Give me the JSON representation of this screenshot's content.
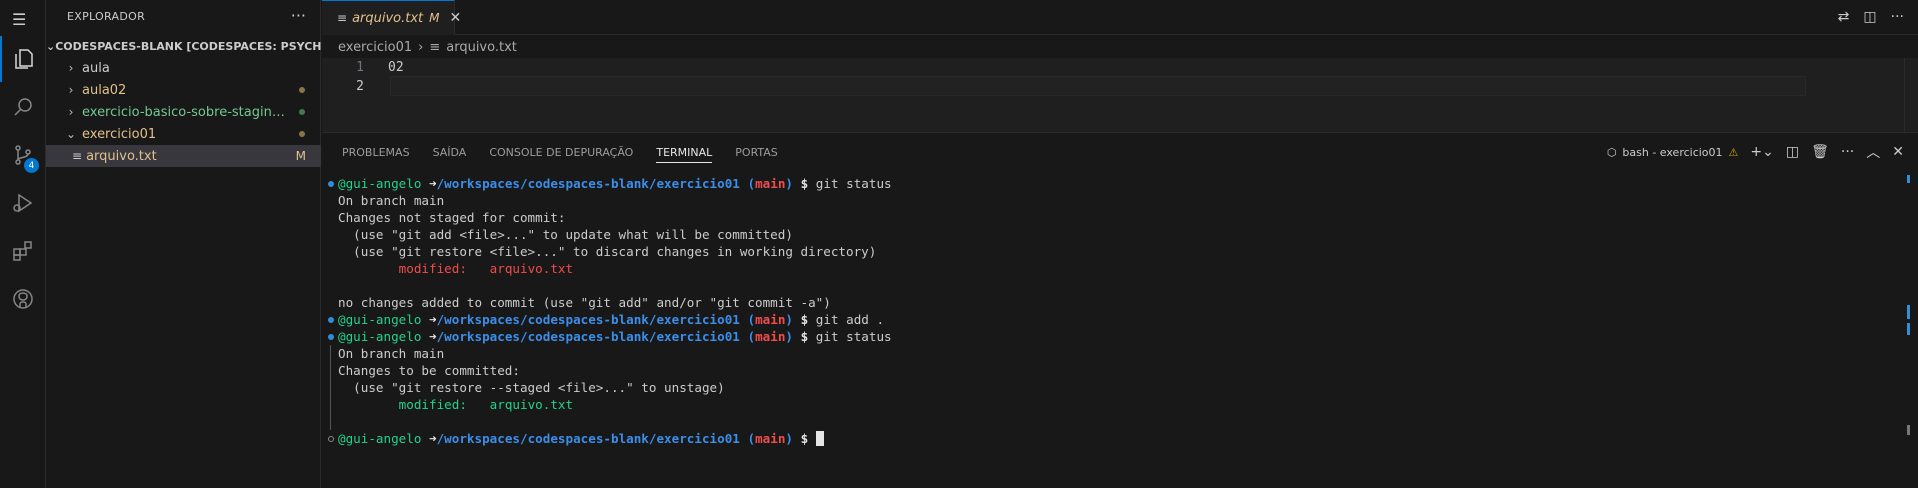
{
  "activity_bar": {
    "items": [
      "explorer",
      "search",
      "source-control",
      "run-debug",
      "extensions",
      "github"
    ],
    "source_control_badge": "4"
  },
  "sidebar": {
    "title": "EXPLORADOR",
    "more": "···",
    "workspace": "CODESPACES-BLANK [CODESPACES: PSYCHIC S...",
    "items": [
      {
        "label": "aula",
        "color": "#cccccc"
      },
      {
        "label": "aula02",
        "color": "#e2c08d"
      },
      {
        "label": "exercicio-basico-sobre-staging-e-...",
        "color": "#73c991"
      },
      {
        "label": "exercicio01",
        "color": "#e2c08d"
      },
      {
        "label": "arquivo.txt",
        "color": "#e2c08d",
        "status": "M"
      }
    ]
  },
  "editor": {
    "tab": {
      "label": "arquivo.txt",
      "status": "M",
      "close": "✕"
    },
    "breadcrumb": [
      "exercicio01",
      "arquivo.txt"
    ],
    "lines": [
      {
        "number": "1",
        "text": "02"
      },
      {
        "number": "2",
        "text": ""
      }
    ]
  },
  "panel": {
    "tabs": [
      "PROBLEMAS",
      "SAÍDA",
      "CONSOLE DE DEPURAÇÃO",
      "TERMINAL",
      "PORTAS"
    ],
    "active_tab": "TERMINAL",
    "terminal_name": "bash - exercicio01"
  },
  "terminal": {
    "user": "@gui-angelo",
    "arrow": "➜",
    "path": "/workspaces/codespaces-blank/exercicio01",
    "branch": "main",
    "lines": {
      "cmd1": "git status",
      "l1": "On branch main",
      "l2": "Changes not staged for commit:",
      "l3": "  (use \"git add <file>...\" to update what will be committed)",
      "l4": "  (use \"git restore <file>...\" to discard changes in working directory)",
      "mod_label": "modified:",
      "mod_file": "arquivo.txt",
      "l6": "no changes added to commit (use \"git add\" and/or \"git commit -a\")",
      "cmd2": "git add .",
      "cmd3": "git status",
      "l7": "On branch main",
      "l8": "Changes to be committed:",
      "l9": "  (use \"git restore --staged <file>...\" to unstage)"
    }
  },
  "colors": {
    "accent": "#0078d4",
    "modified": "#e2c08d",
    "untracked": "#73c991"
  }
}
